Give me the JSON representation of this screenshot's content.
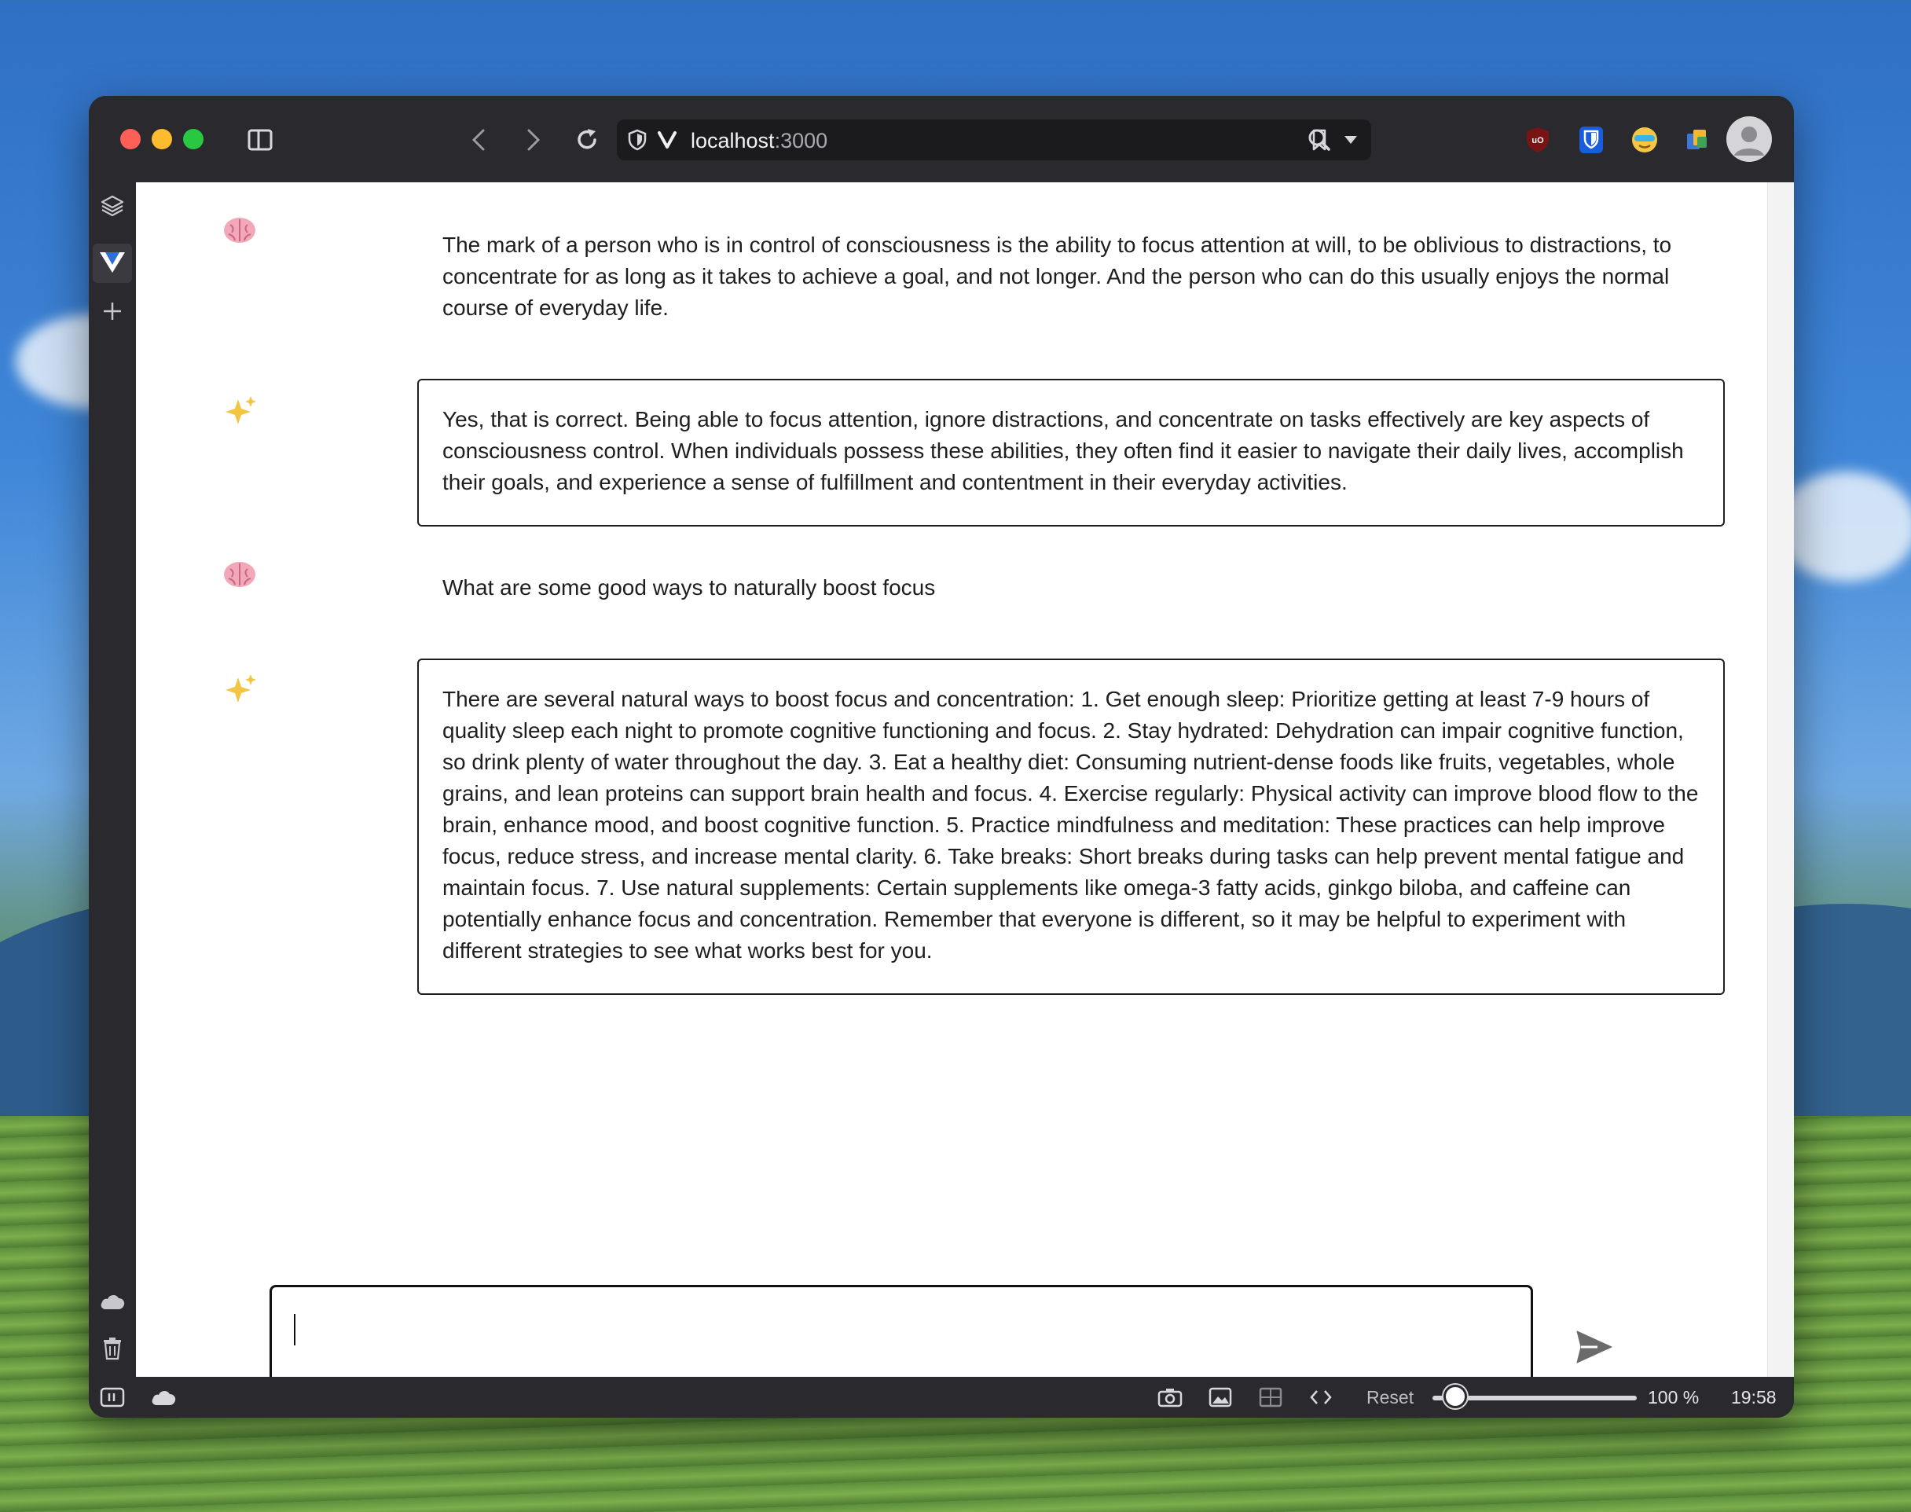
{
  "browser": {
    "address_host": "localhost",
    "address_port": ":3000"
  },
  "messages": [
    {
      "role": "user",
      "icon": "brain-icon",
      "text": "The mark of a person who is in control of consciousness is the ability to focus attention at will, to be oblivious to distractions, to concentrate for as long as it takes to achieve a goal, and not longer. And the person who can do this usually enjoys the normal course of everyday life."
    },
    {
      "role": "assistant",
      "icon": "sparkles-icon",
      "text": "Yes, that is correct. Being able to focus attention, ignore distractions, and concentrate on tasks effectively are key aspects of consciousness control. When individuals possess these abilities, they often find it easier to navigate their daily lives, accomplish their goals, and experience a sense of fulfillment and contentment in their everyday activities."
    },
    {
      "role": "user",
      "icon": "brain-icon",
      "text": "What are some good ways to naturally boost focus"
    },
    {
      "role": "assistant",
      "icon": "sparkles-icon",
      "text": "There are several natural ways to boost focus and concentration: 1. Get enough sleep: Prioritize getting at least 7-9 hours of quality sleep each night to promote cognitive functioning and focus. 2. Stay hydrated: Dehydration can impair cognitive function, so drink plenty of water throughout the day. 3. Eat a healthy diet: Consuming nutrient-dense foods like fruits, vegetables, whole grains, and lean proteins can support brain health and focus. 4. Exercise regularly: Physical activity can improve blood flow to the brain, enhance mood, and boost cognitive function. 5. Practice mindfulness and meditation: These practices can help improve focus, reduce stress, and increase mental clarity. 6. Take breaks: Short breaks during tasks can help prevent mental fatigue and maintain focus. 7. Use natural supplements: Certain supplements like omega-3 fatty acids, ginkgo biloba, and caffeine can potentially enhance focus and concentration. Remember that everyone is different, so it may be helpful to experiment with different strategies to see what works best for you."
    }
  ],
  "composer": {
    "value": ""
  },
  "statusbar": {
    "reset_label": "Reset",
    "zoom_label": "100 %",
    "zoom_level": 1.0,
    "clock": "19:58"
  },
  "colors": {
    "window_chrome": "#2a2a2e",
    "close": "#fe5f57",
    "minimize": "#febc2e",
    "maximize": "#28c840"
  }
}
